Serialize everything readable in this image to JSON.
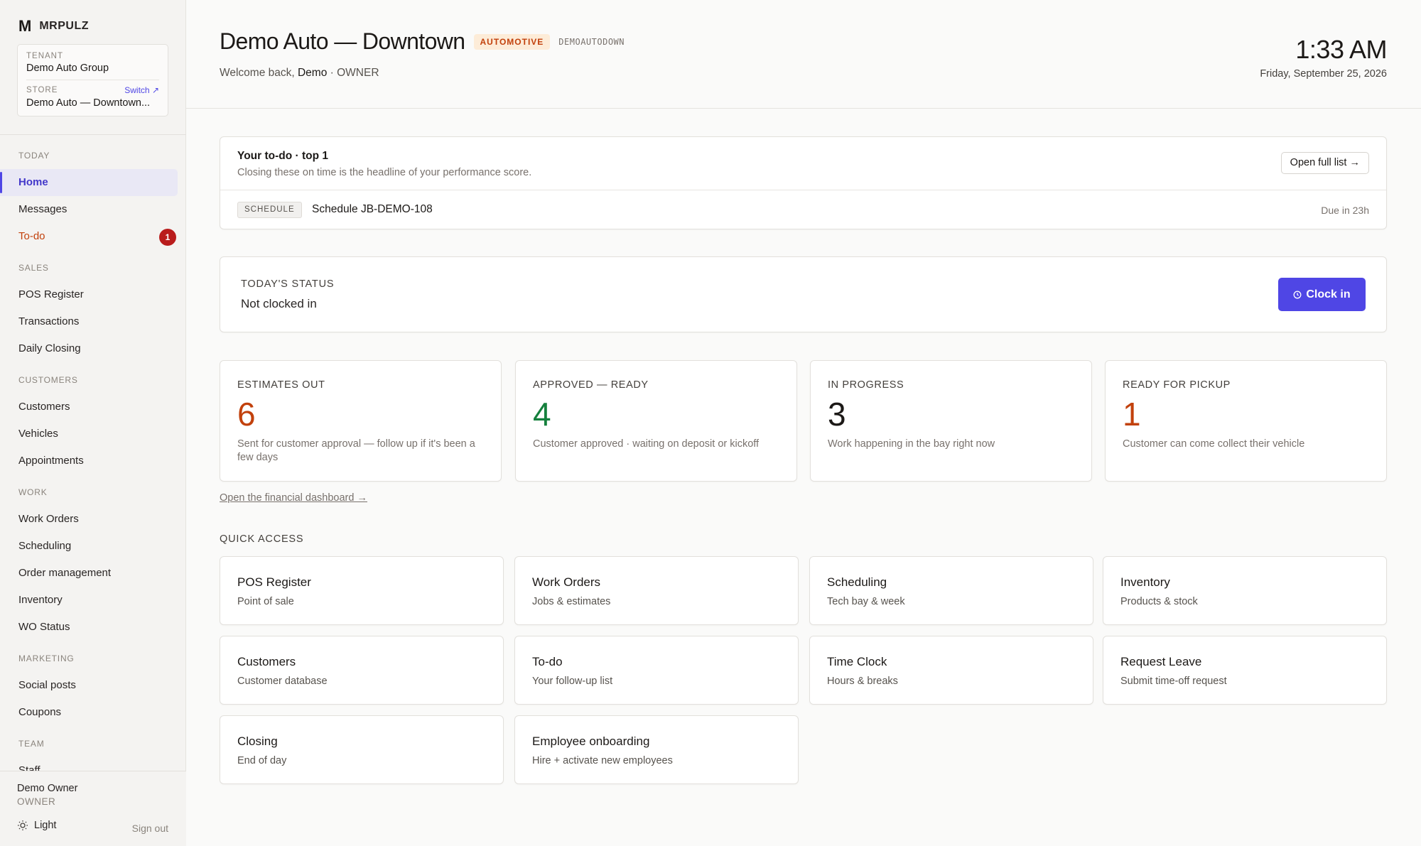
{
  "brand": {
    "logo": "M",
    "name": "MRPULZ"
  },
  "tenant": {
    "tenant_label": "TENANT",
    "tenant_name": "Demo Auto Group",
    "store_label": "STORE",
    "switch_label": "Switch ↗",
    "store_name": "Demo Auto — Downtown..."
  },
  "nav": {
    "sections": [
      {
        "label": "TODAY",
        "items": [
          {
            "label": "Home",
            "active": true
          },
          {
            "label": "Messages"
          },
          {
            "label": "To-do",
            "badge": "1"
          }
        ]
      },
      {
        "label": "SALES",
        "items": [
          {
            "label": "POS Register"
          },
          {
            "label": "Transactions"
          },
          {
            "label": "Daily Closing"
          }
        ]
      },
      {
        "label": "CUSTOMERS",
        "items": [
          {
            "label": "Customers"
          },
          {
            "label": "Vehicles"
          },
          {
            "label": "Appointments"
          }
        ]
      },
      {
        "label": "WORK",
        "items": [
          {
            "label": "Work Orders"
          },
          {
            "label": "Scheduling"
          },
          {
            "label": "Order management"
          },
          {
            "label": "Inventory"
          },
          {
            "label": "WO Status"
          }
        ]
      },
      {
        "label": "MARKETING",
        "items": [
          {
            "label": "Social posts"
          },
          {
            "label": "Coupons"
          }
        ]
      },
      {
        "label": "TEAM",
        "items": [
          {
            "label": "Staff"
          }
        ]
      }
    ]
  },
  "footer": {
    "user_name": "Demo Owner",
    "user_role": "OWNER",
    "theme_label": "Light",
    "theme_icon": "sun-icon",
    "sign_out_label": "Sign out"
  },
  "header": {
    "title": "Demo Auto — Downtown",
    "industry_tag": "AUTOMOTIVE",
    "store_code": "DEMOAUTODOWN",
    "welcome_prefix": "Welcome back,",
    "welcome_name": "Demo",
    "welcome_suffix": "· OWNER",
    "time": "1:33 AM",
    "date": "Friday, September 25, 2026"
  },
  "todo": {
    "title": "Your to-do · top 1",
    "subtitle": "Closing these on time is the headline of your performance score.",
    "open_full_list_label": "Open full list →",
    "items": [
      {
        "tag": "SCHEDULE",
        "text": "Schedule JB-DEMO-108",
        "due": "Due in 23h"
      }
    ]
  },
  "status": {
    "label": "TODAY'S STATUS",
    "value": "Not clocked in",
    "clock_in_label": "Clock in",
    "clock_in_icon": "clock-icon",
    "primary_color": "#4f46e5"
  },
  "metrics": [
    {
      "label": "ESTIMATES OUT",
      "value": "6",
      "desc": "Sent for customer approval — follow up if it's been a few days",
      "color": "#c2410c"
    },
    {
      "label": "APPROVED — READY",
      "value": "4",
      "desc": "Customer approved · waiting on deposit or kickoff",
      "color": "#15803d"
    },
    {
      "label": "IN PROGRESS",
      "value": "3",
      "desc": "Work happening in the bay right now",
      "color": "#1c1917"
    },
    {
      "label": "READY FOR PICKUP",
      "value": "1",
      "desc": "Customer can come collect their vehicle",
      "color": "#c2410c"
    }
  ],
  "financial_link": "Open the financial dashboard →",
  "quick_access": {
    "heading": "QUICK ACCESS",
    "items": [
      {
        "title": "POS Register",
        "subtitle": "Point of sale"
      },
      {
        "title": "Work Orders",
        "subtitle": "Jobs & estimates"
      },
      {
        "title": "Scheduling",
        "subtitle": "Tech bay & week"
      },
      {
        "title": "Inventory",
        "subtitle": "Products & stock"
      },
      {
        "title": "Customers",
        "subtitle": "Customer database"
      },
      {
        "title": "To-do",
        "subtitle": "Your follow-up list"
      },
      {
        "title": "Time Clock",
        "subtitle": "Hours & breaks"
      },
      {
        "title": "Request Leave",
        "subtitle": "Submit time-off request"
      },
      {
        "title": "Closing",
        "subtitle": "End of day"
      },
      {
        "title": "Employee onboarding",
        "subtitle": "Hire + activate new employees"
      }
    ]
  }
}
